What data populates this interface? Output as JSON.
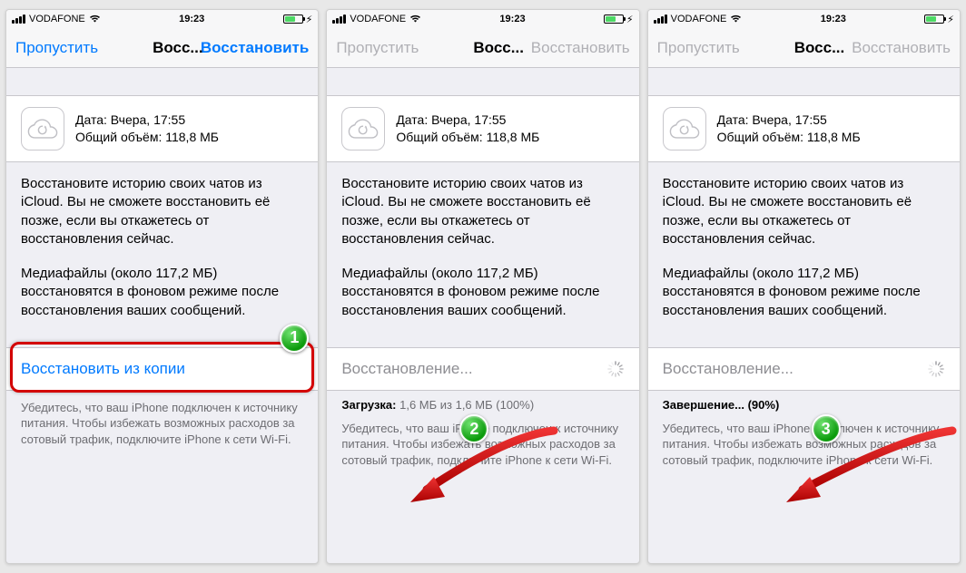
{
  "status": {
    "carrier": "VODAFONE",
    "time": "19:23",
    "wifi_symbol": "wifi-icon",
    "batt_bolt": "⚡︎"
  },
  "nav": {
    "skip": "Пропустить",
    "title": "Восс...",
    "restore": "Восстановить"
  },
  "backup": {
    "date_line": "Дата: Вчера, 17:55",
    "size_line": "Общий объём: 118,8 МБ"
  },
  "paragraph1": "Восстановите историю своих чатов из iCloud. Вы не сможете восстановить её позже, если вы откажетесь от восстановления сейчас.",
  "paragraph2": "Медиафайлы (около 117,2 МБ) восстановятся в фоновом режиме после восстановления ваших сообщений.",
  "screen1": {
    "action": "Восстановить из копии"
  },
  "screen2": {
    "action": "Восстановление...",
    "progress_prefix": "Загрузка:",
    "progress_rest": " 1,6 МБ из 1,6 МБ (100%)"
  },
  "screen3": {
    "action": "Восстановление...",
    "progress_prefix": "Завершение... (90%)",
    "progress_rest": ""
  },
  "footer_note": "Убедитесь, что ваш iPhone подключен к источнику питания. Чтобы избежать возможных расходов за сотовый трафик, подключите iPhone к сети Wi-Fi.",
  "badges": {
    "b1": "1",
    "b2": "2",
    "b3": "3"
  }
}
